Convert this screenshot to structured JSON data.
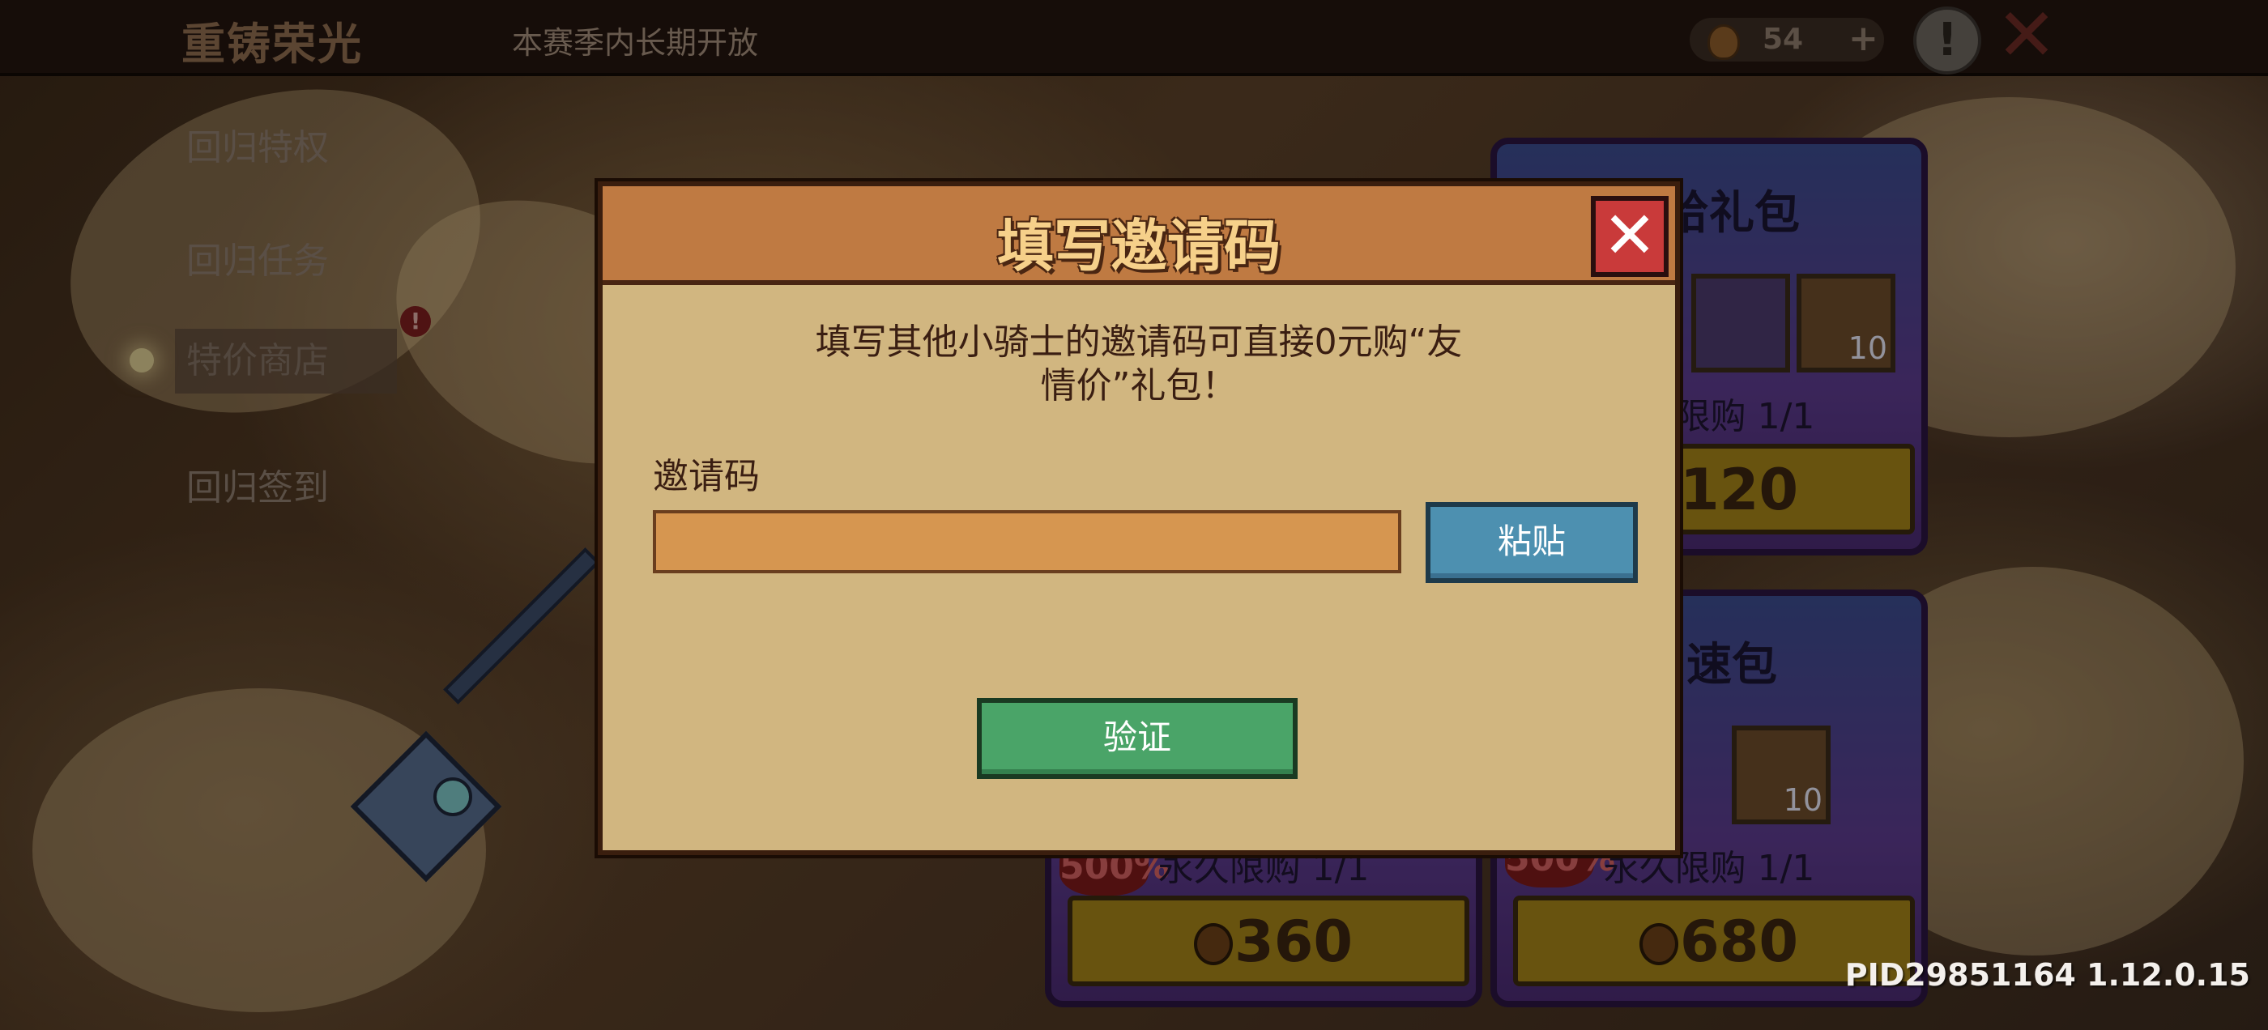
{
  "topbar": {
    "title": "重铸荣光",
    "subtitle": "本赛季内长期开放",
    "currency_amount": "54",
    "currency_plus": "+",
    "alert_symbol": "!",
    "close_symbol": "✕"
  },
  "sidemenu": {
    "items": [
      {
        "label": "回归特权"
      },
      {
        "label": "回归任务"
      },
      {
        "label": "特价商店"
      },
      {
        "label": "回归签到"
      }
    ],
    "badge": "!"
  },
  "cards": [
    {
      "title": "补给礼包",
      "item_count": "10",
      "limit": "永久限购 1/1",
      "price": "120"
    },
    {
      "title": "加速包",
      "item_count": "10",
      "limit": "永久限购 1/1",
      "price": "680",
      "tag": "500%"
    },
    {
      "limit": "永久限购 1/1",
      "price": "360",
      "tag": "500%"
    }
  ],
  "modal": {
    "title": "填写邀请码",
    "close_symbol": "✕",
    "description_line1": "填写其他小骑士的邀请码可直接0元购“友",
    "description_line2": "情价”礼包！",
    "code_label": "邀请码",
    "code_value": "",
    "code_placeholder": "",
    "paste_label": "粘贴",
    "verify_label": "验证"
  },
  "footer": {
    "pid": "PID29851164 1.12.0.15"
  },
  "colors": {
    "modal_bg": "#d1b680",
    "header_bg": "#bf7a42",
    "paste_btn": "#4d90b0",
    "verify_btn": "#4aa468",
    "close_btn": "#c93a3a"
  }
}
